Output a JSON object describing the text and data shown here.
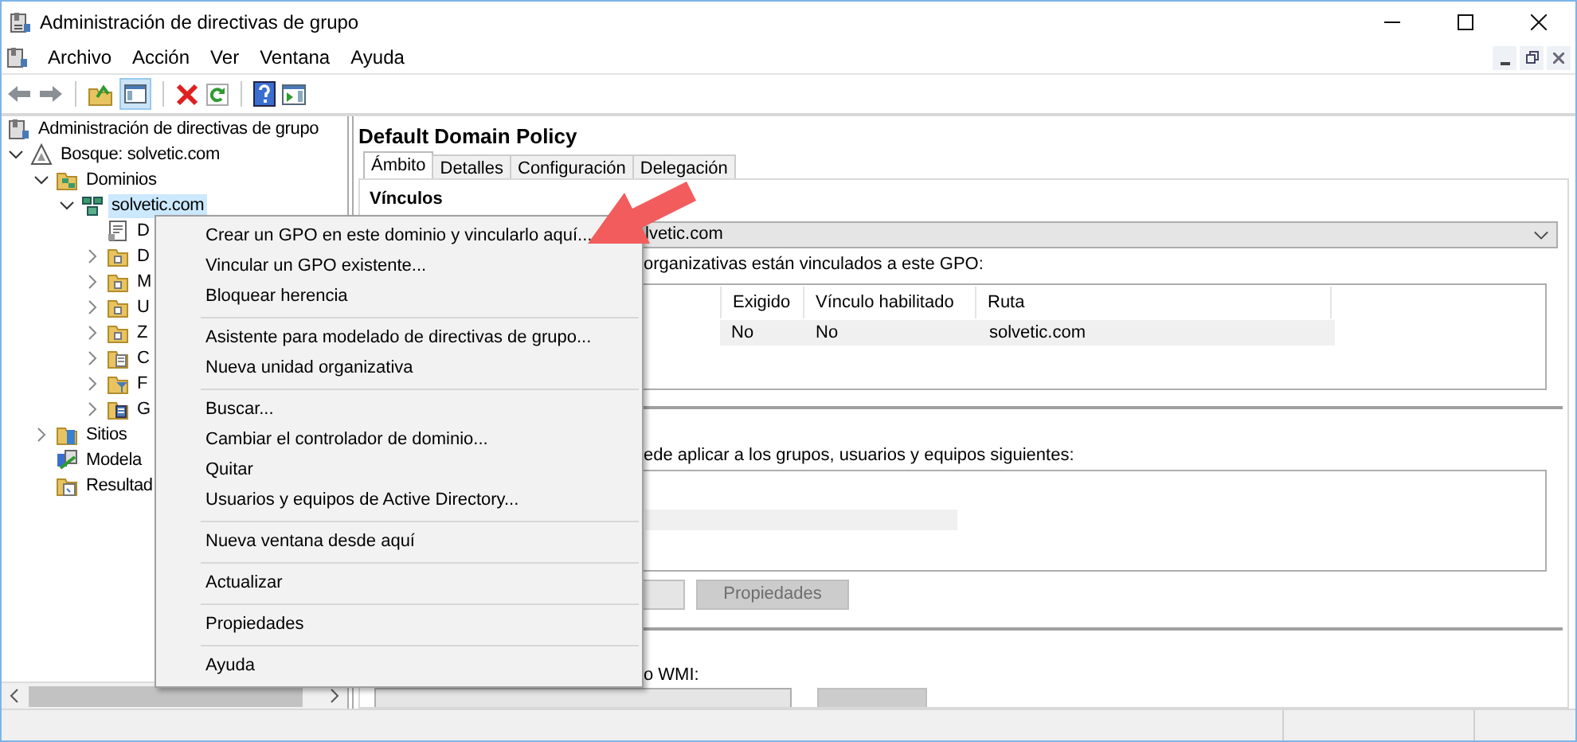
{
  "window": {
    "title": "Administración de directivas de grupo"
  },
  "menu_bar": [
    "Archivo",
    "Acción",
    "Ver",
    "Ventana",
    "Ayuda"
  ],
  "tree": [
    {
      "label": "Administración de directivas de grupo",
      "kind": "console",
      "selected": false,
      "children": [
        {
          "label": "Bosque: solvetic.com",
          "kind": "forest",
          "expanded": true,
          "selected": false,
          "children": [
            {
              "label": "Dominios",
              "kind": "domains",
              "expanded": true,
              "selected": false,
              "children": [
                {
                  "label": "solvetic.com",
                  "kind": "domain",
                  "expanded": true,
                  "selected": true,
                  "children": [
                    {
                      "label": "D",
                      "kind": "gpo",
                      "selected": false
                    },
                    {
                      "label": "D",
                      "kind": "ou",
                      "expanded": false,
                      "selected": false
                    },
                    {
                      "label": "M",
                      "kind": "ou",
                      "expanded": false,
                      "selected": false
                    },
                    {
                      "label": "U",
                      "kind": "ou",
                      "expanded": false,
                      "selected": false
                    },
                    {
                      "label": "Z",
                      "kind": "ou",
                      "expanded": false,
                      "selected": false
                    },
                    {
                      "label": "C",
                      "kind": "gpo-folder",
                      "expanded": false,
                      "selected": false
                    },
                    {
                      "label": "F",
                      "kind": "wmi-folder",
                      "expanded": false,
                      "selected": false
                    },
                    {
                      "label": "G",
                      "kind": "starter-folder",
                      "expanded": false,
                      "selected": false
                    }
                  ]
                }
              ]
            },
            {
              "label": "Sitios",
              "kind": "sites",
              "expanded": false,
              "selected": false
            },
            {
              "label": "Modela",
              "kind": "modeling",
              "selected": false
            },
            {
              "label": "Resultad",
              "kind": "results",
              "selected": false
            }
          ]
        }
      ]
    }
  ],
  "details": {
    "title": "Default Domain Policy",
    "tabs": [
      {
        "label": "Ámbito",
        "selected": true
      },
      {
        "label": "Detalles",
        "selected": false
      },
      {
        "label": "Configuración",
        "selected": false
      },
      {
        "label": "Delegación",
        "selected": false
      }
    ],
    "links": {
      "heading": "Vínculos",
      "location": "lvetic.com",
      "caption": "organizativas están vinculados a este GPO:",
      "columns": [
        "Exigido",
        "Vínculo habilitado",
        "Ruta"
      ],
      "rows": [
        [
          "No",
          "No",
          "solvetic.com"
        ]
      ]
    },
    "security_filter": {
      "caption": "ede aplicar a los grupos, usuarios y equipos siguientes:",
      "buttons": [
        {
          "label": "Propiedades",
          "disabled": true
        }
      ]
    },
    "wmi_filter": {
      "caption": "o WMI:"
    }
  },
  "context_menu": {
    "groups": [
      [
        "Crear un GPO en este dominio y vincularlo aquí...",
        "Vincular un GPO existente...",
        "Bloquear herencia"
      ],
      [
        "Asistente para modelado de directivas de grupo...",
        "Nueva unidad organizativa"
      ],
      [
        "Buscar...",
        "Cambiar el controlador de dominio...",
        "Quitar",
        "Usuarios y equipos de Active Directory..."
      ],
      [
        "Nueva ventana desde aquí"
      ],
      [
        "Actualizar"
      ],
      [
        "Propiedades"
      ],
      [
        "Ayuda"
      ]
    ]
  }
}
